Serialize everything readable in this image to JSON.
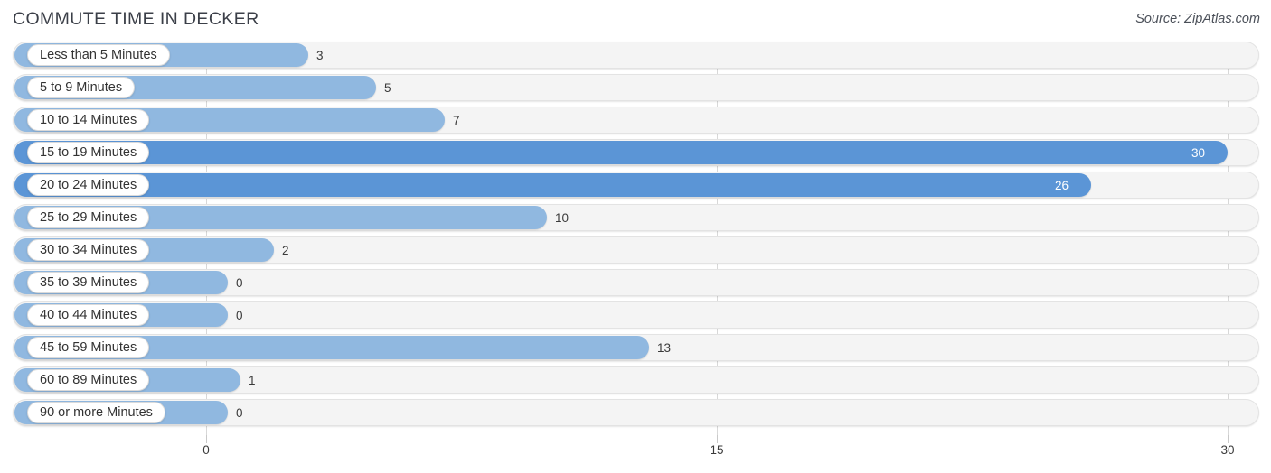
{
  "header": {
    "title": "COMMUTE TIME IN DECKER",
    "source": "Source: ZipAtlas.com"
  },
  "colors": {
    "bar_light": "#90b8e0",
    "bar_dark": "#5b95d6",
    "track": "#f4f4f4",
    "track_border": "#e3e3e3",
    "gridline": "#d8d8d8",
    "label_text": "#333333",
    "value_text": "#3a3a3a",
    "value_text_inside": "#ffffff",
    "title_text": "#3b3f48"
  },
  "chart_data": {
    "type": "bar",
    "orientation": "horizontal",
    "title": "COMMUTE TIME IN DECKER",
    "xlabel": "",
    "ylabel": "",
    "xlim": [
      0,
      30
    ],
    "grid": true,
    "legend": null,
    "source": "Source: ZipAtlas.com",
    "axis_ticks": [
      "0",
      "15",
      "30"
    ],
    "axis_tick_values": [
      0,
      15,
      30
    ],
    "categories": [
      "Less than 5 Minutes",
      "5 to 9 Minutes",
      "10 to 14 Minutes",
      "15 to 19 Minutes",
      "20 to 24 Minutes",
      "25 to 29 Minutes",
      "30 to 34 Minutes",
      "35 to 39 Minutes",
      "40 to 44 Minutes",
      "45 to 59 Minutes",
      "60 to 89 Minutes",
      "90 or more Minutes"
    ],
    "values": [
      3,
      5,
      7,
      30,
      26,
      10,
      2,
      0,
      0,
      13,
      1,
      0
    ],
    "value_labels": [
      "3",
      "5",
      "7",
      "30",
      "26",
      "10",
      "2",
      "0",
      "0",
      "13",
      "1",
      "0"
    ]
  },
  "rows": [
    {
      "label": "Less than 5 Minutes",
      "value": "3",
      "highlight": false,
      "inside": false
    },
    {
      "label": "5 to 9 Minutes",
      "value": "5",
      "highlight": false,
      "inside": false
    },
    {
      "label": "10 to 14 Minutes",
      "value": "7",
      "highlight": false,
      "inside": false
    },
    {
      "label": "15 to 19 Minutes",
      "value": "30",
      "highlight": true,
      "inside": true
    },
    {
      "label": "20 to 24 Minutes",
      "value": "26",
      "highlight": true,
      "inside": true
    },
    {
      "label": "25 to 29 Minutes",
      "value": "10",
      "highlight": false,
      "inside": false
    },
    {
      "label": "30 to 34 Minutes",
      "value": "2",
      "highlight": false,
      "inside": false
    },
    {
      "label": "35 to 39 Minutes",
      "value": "0",
      "highlight": false,
      "inside": false
    },
    {
      "label": "40 to 44 Minutes",
      "value": "0",
      "highlight": false,
      "inside": false
    },
    {
      "label": "45 to 59 Minutes",
      "value": "13",
      "highlight": false,
      "inside": false
    },
    {
      "label": "60 to 89 Minutes",
      "value": "1",
      "highlight": false,
      "inside": false
    },
    {
      "label": "90 or more Minutes",
      "value": "0",
      "highlight": false,
      "inside": false
    }
  ]
}
